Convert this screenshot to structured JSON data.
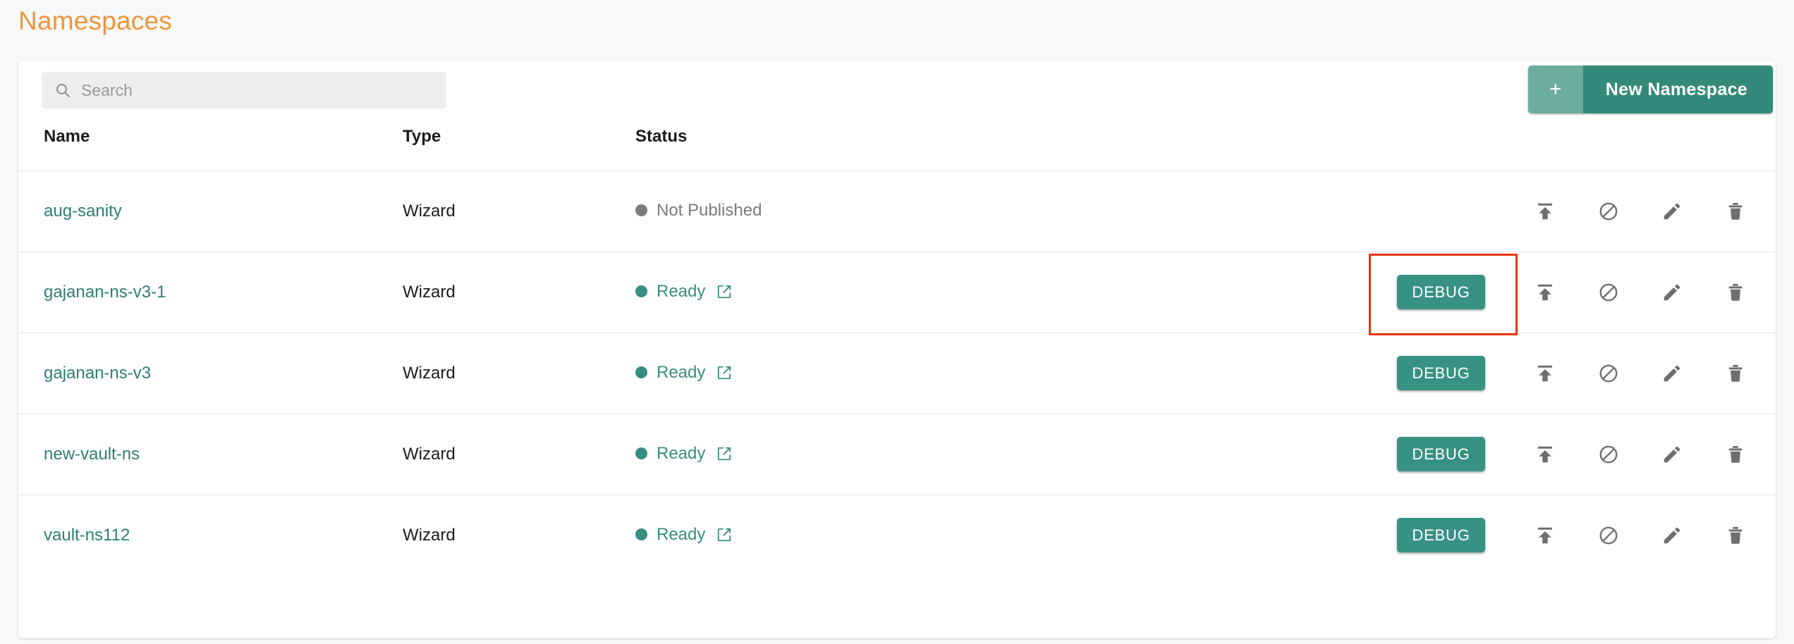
{
  "page": {
    "title": "Namespaces",
    "title_color": "#f0963c"
  },
  "toolbar": {
    "search_placeholder": "Search",
    "search_value": "",
    "search_icon": "search-icon",
    "new_namespace_plus": "+",
    "new_namespace_label": "New Namespace",
    "new_namespace_color": "#338a7a"
  },
  "table": {
    "columns": [
      "Name",
      "Type",
      "Status",
      ""
    ],
    "rows": [
      {
        "name": "aug-sanity",
        "type": "Wizard",
        "status": "Not Published",
        "status_state": "not-published",
        "status_color": "#7b7b7b",
        "has_external_link": false,
        "debug_label": "",
        "has_debug": false,
        "highlighted": false
      },
      {
        "name": "gajanan-ns-v3-1",
        "type": "Wizard",
        "status": "Ready",
        "status_state": "ready",
        "status_color": "#388e80",
        "has_external_link": true,
        "debug_label": "DEBUG",
        "has_debug": true,
        "highlighted": true
      },
      {
        "name": "gajanan-ns-v3",
        "type": "Wizard",
        "status": "Ready",
        "status_state": "ready",
        "status_color": "#388e80",
        "has_external_link": true,
        "debug_label": "DEBUG",
        "has_debug": true,
        "highlighted": false
      },
      {
        "name": "new-vault-ns",
        "type": "Wizard",
        "status": "Ready",
        "status_state": "ready",
        "status_color": "#388e80",
        "has_external_link": true,
        "debug_label": "DEBUG",
        "has_debug": true,
        "highlighted": false
      },
      {
        "name": "vault-ns112",
        "type": "Wizard",
        "status": "Ready",
        "status_state": "ready",
        "status_color": "#388e80",
        "has_external_link": true,
        "debug_label": "DEBUG",
        "has_debug": true,
        "highlighted": false
      }
    ],
    "row_actions": [
      {
        "icon": "publish-icon",
        "name": "publish-button"
      },
      {
        "icon": "unpublish-icon",
        "name": "unpublish-button"
      },
      {
        "icon": "edit-icon",
        "name": "edit-button"
      },
      {
        "icon": "delete-icon",
        "name": "delete-button"
      }
    ]
  },
  "highlight": {
    "color": "#e8350d",
    "target": "debug-button-gajanan-ns-v3-1"
  }
}
